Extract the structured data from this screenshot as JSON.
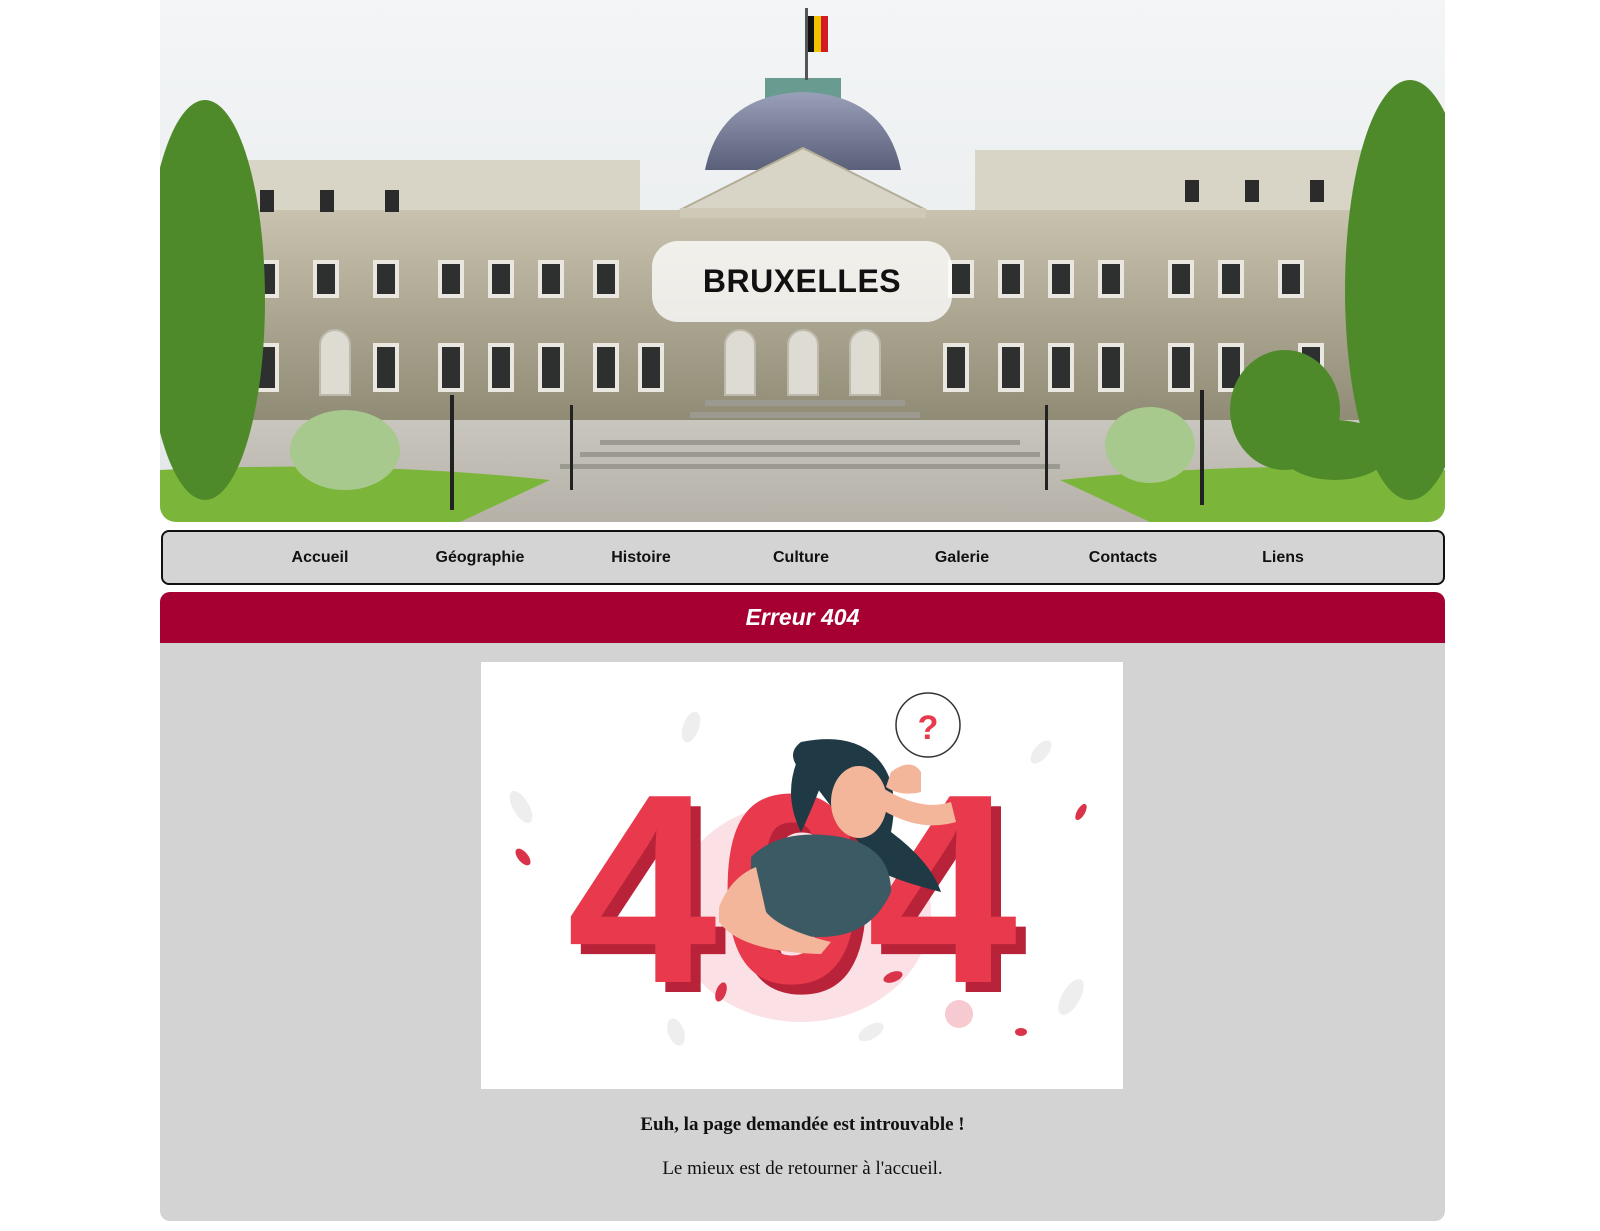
{
  "banner": {
    "title": "BRUXELLES",
    "image_icon": "palace-photo"
  },
  "nav": {
    "items": [
      {
        "label": "Accueil"
      },
      {
        "label": "Géographie"
      },
      {
        "label": "Histoire"
      },
      {
        "label": "Culture"
      },
      {
        "label": "Galerie"
      },
      {
        "label": "Contacts"
      },
      {
        "label": "Liens"
      }
    ]
  },
  "main": {
    "title": "Erreur 404",
    "illustration_icon": "404-illustration",
    "illustration_text": "404",
    "message_bold": "Euh, la page demandée est introuvable !",
    "message": "Le mieux est de retourner à l'accueil."
  },
  "colors": {
    "header_bar": "#a50031",
    "panel_bg": "#d3d3d3",
    "nav_bg": "#d4d4d4",
    "accent_red": "#e8394d"
  }
}
